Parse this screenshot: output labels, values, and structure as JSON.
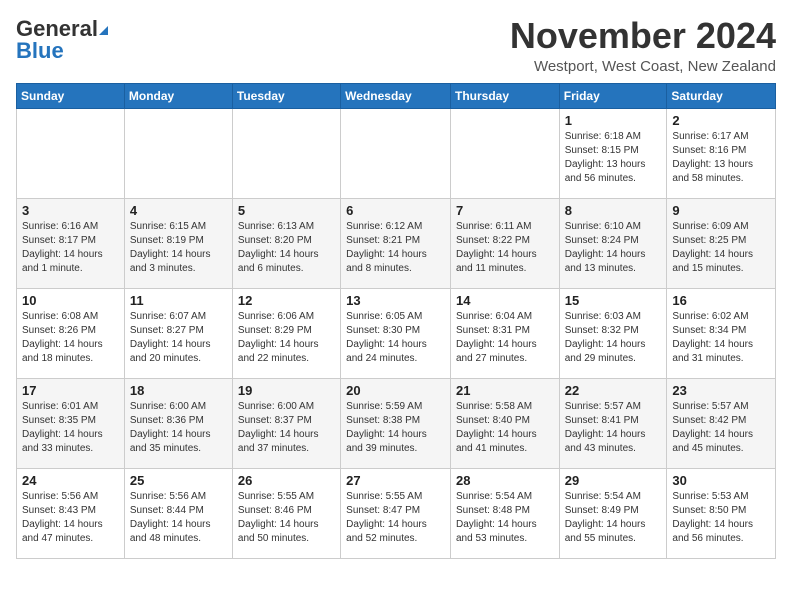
{
  "header": {
    "logo_general": "General",
    "logo_blue": "Blue",
    "month_title": "November 2024",
    "location": "Westport, West Coast, New Zealand"
  },
  "calendar": {
    "days_of_week": [
      "Sunday",
      "Monday",
      "Tuesday",
      "Wednesday",
      "Thursday",
      "Friday",
      "Saturday"
    ],
    "weeks": [
      [
        {
          "day": "",
          "sunrise": "",
          "sunset": "",
          "daylight": ""
        },
        {
          "day": "",
          "sunrise": "",
          "sunset": "",
          "daylight": ""
        },
        {
          "day": "",
          "sunrise": "",
          "sunset": "",
          "daylight": ""
        },
        {
          "day": "",
          "sunrise": "",
          "sunset": "",
          "daylight": ""
        },
        {
          "day": "",
          "sunrise": "",
          "sunset": "",
          "daylight": ""
        },
        {
          "day": "1",
          "sunrise": "Sunrise: 6:18 AM",
          "sunset": "Sunset: 8:15 PM",
          "daylight": "Daylight: 13 hours and 56 minutes."
        },
        {
          "day": "2",
          "sunrise": "Sunrise: 6:17 AM",
          "sunset": "Sunset: 8:16 PM",
          "daylight": "Daylight: 13 hours and 58 minutes."
        }
      ],
      [
        {
          "day": "3",
          "sunrise": "Sunrise: 6:16 AM",
          "sunset": "Sunset: 8:17 PM",
          "daylight": "Daylight: 14 hours and 1 minute."
        },
        {
          "day": "4",
          "sunrise": "Sunrise: 6:15 AM",
          "sunset": "Sunset: 8:19 PM",
          "daylight": "Daylight: 14 hours and 3 minutes."
        },
        {
          "day": "5",
          "sunrise": "Sunrise: 6:13 AM",
          "sunset": "Sunset: 8:20 PM",
          "daylight": "Daylight: 14 hours and 6 minutes."
        },
        {
          "day": "6",
          "sunrise": "Sunrise: 6:12 AM",
          "sunset": "Sunset: 8:21 PM",
          "daylight": "Daylight: 14 hours and 8 minutes."
        },
        {
          "day": "7",
          "sunrise": "Sunrise: 6:11 AM",
          "sunset": "Sunset: 8:22 PM",
          "daylight": "Daylight: 14 hours and 11 minutes."
        },
        {
          "day": "8",
          "sunrise": "Sunrise: 6:10 AM",
          "sunset": "Sunset: 8:24 PM",
          "daylight": "Daylight: 14 hours and 13 minutes."
        },
        {
          "day": "9",
          "sunrise": "Sunrise: 6:09 AM",
          "sunset": "Sunset: 8:25 PM",
          "daylight": "Daylight: 14 hours and 15 minutes."
        }
      ],
      [
        {
          "day": "10",
          "sunrise": "Sunrise: 6:08 AM",
          "sunset": "Sunset: 8:26 PM",
          "daylight": "Daylight: 14 hours and 18 minutes."
        },
        {
          "day": "11",
          "sunrise": "Sunrise: 6:07 AM",
          "sunset": "Sunset: 8:27 PM",
          "daylight": "Daylight: 14 hours and 20 minutes."
        },
        {
          "day": "12",
          "sunrise": "Sunrise: 6:06 AM",
          "sunset": "Sunset: 8:29 PM",
          "daylight": "Daylight: 14 hours and 22 minutes."
        },
        {
          "day": "13",
          "sunrise": "Sunrise: 6:05 AM",
          "sunset": "Sunset: 8:30 PM",
          "daylight": "Daylight: 14 hours and 24 minutes."
        },
        {
          "day": "14",
          "sunrise": "Sunrise: 6:04 AM",
          "sunset": "Sunset: 8:31 PM",
          "daylight": "Daylight: 14 hours and 27 minutes."
        },
        {
          "day": "15",
          "sunrise": "Sunrise: 6:03 AM",
          "sunset": "Sunset: 8:32 PM",
          "daylight": "Daylight: 14 hours and 29 minutes."
        },
        {
          "day": "16",
          "sunrise": "Sunrise: 6:02 AM",
          "sunset": "Sunset: 8:34 PM",
          "daylight": "Daylight: 14 hours and 31 minutes."
        }
      ],
      [
        {
          "day": "17",
          "sunrise": "Sunrise: 6:01 AM",
          "sunset": "Sunset: 8:35 PM",
          "daylight": "Daylight: 14 hours and 33 minutes."
        },
        {
          "day": "18",
          "sunrise": "Sunrise: 6:00 AM",
          "sunset": "Sunset: 8:36 PM",
          "daylight": "Daylight: 14 hours and 35 minutes."
        },
        {
          "day": "19",
          "sunrise": "Sunrise: 6:00 AM",
          "sunset": "Sunset: 8:37 PM",
          "daylight": "Daylight: 14 hours and 37 minutes."
        },
        {
          "day": "20",
          "sunrise": "Sunrise: 5:59 AM",
          "sunset": "Sunset: 8:38 PM",
          "daylight": "Daylight: 14 hours and 39 minutes."
        },
        {
          "day": "21",
          "sunrise": "Sunrise: 5:58 AM",
          "sunset": "Sunset: 8:40 PM",
          "daylight": "Daylight: 14 hours and 41 minutes."
        },
        {
          "day": "22",
          "sunrise": "Sunrise: 5:57 AM",
          "sunset": "Sunset: 8:41 PM",
          "daylight": "Daylight: 14 hours and 43 minutes."
        },
        {
          "day": "23",
          "sunrise": "Sunrise: 5:57 AM",
          "sunset": "Sunset: 8:42 PM",
          "daylight": "Daylight: 14 hours and 45 minutes."
        }
      ],
      [
        {
          "day": "24",
          "sunrise": "Sunrise: 5:56 AM",
          "sunset": "Sunset: 8:43 PM",
          "daylight": "Daylight: 14 hours and 47 minutes."
        },
        {
          "day": "25",
          "sunrise": "Sunrise: 5:56 AM",
          "sunset": "Sunset: 8:44 PM",
          "daylight": "Daylight: 14 hours and 48 minutes."
        },
        {
          "day": "26",
          "sunrise": "Sunrise: 5:55 AM",
          "sunset": "Sunset: 8:46 PM",
          "daylight": "Daylight: 14 hours and 50 minutes."
        },
        {
          "day": "27",
          "sunrise": "Sunrise: 5:55 AM",
          "sunset": "Sunset: 8:47 PM",
          "daylight": "Daylight: 14 hours and 52 minutes."
        },
        {
          "day": "28",
          "sunrise": "Sunrise: 5:54 AM",
          "sunset": "Sunset: 8:48 PM",
          "daylight": "Daylight: 14 hours and 53 minutes."
        },
        {
          "day": "29",
          "sunrise": "Sunrise: 5:54 AM",
          "sunset": "Sunset: 8:49 PM",
          "daylight": "Daylight: 14 hours and 55 minutes."
        },
        {
          "day": "30",
          "sunrise": "Sunrise: 5:53 AM",
          "sunset": "Sunset: 8:50 PM",
          "daylight": "Daylight: 14 hours and 56 minutes."
        }
      ]
    ]
  }
}
